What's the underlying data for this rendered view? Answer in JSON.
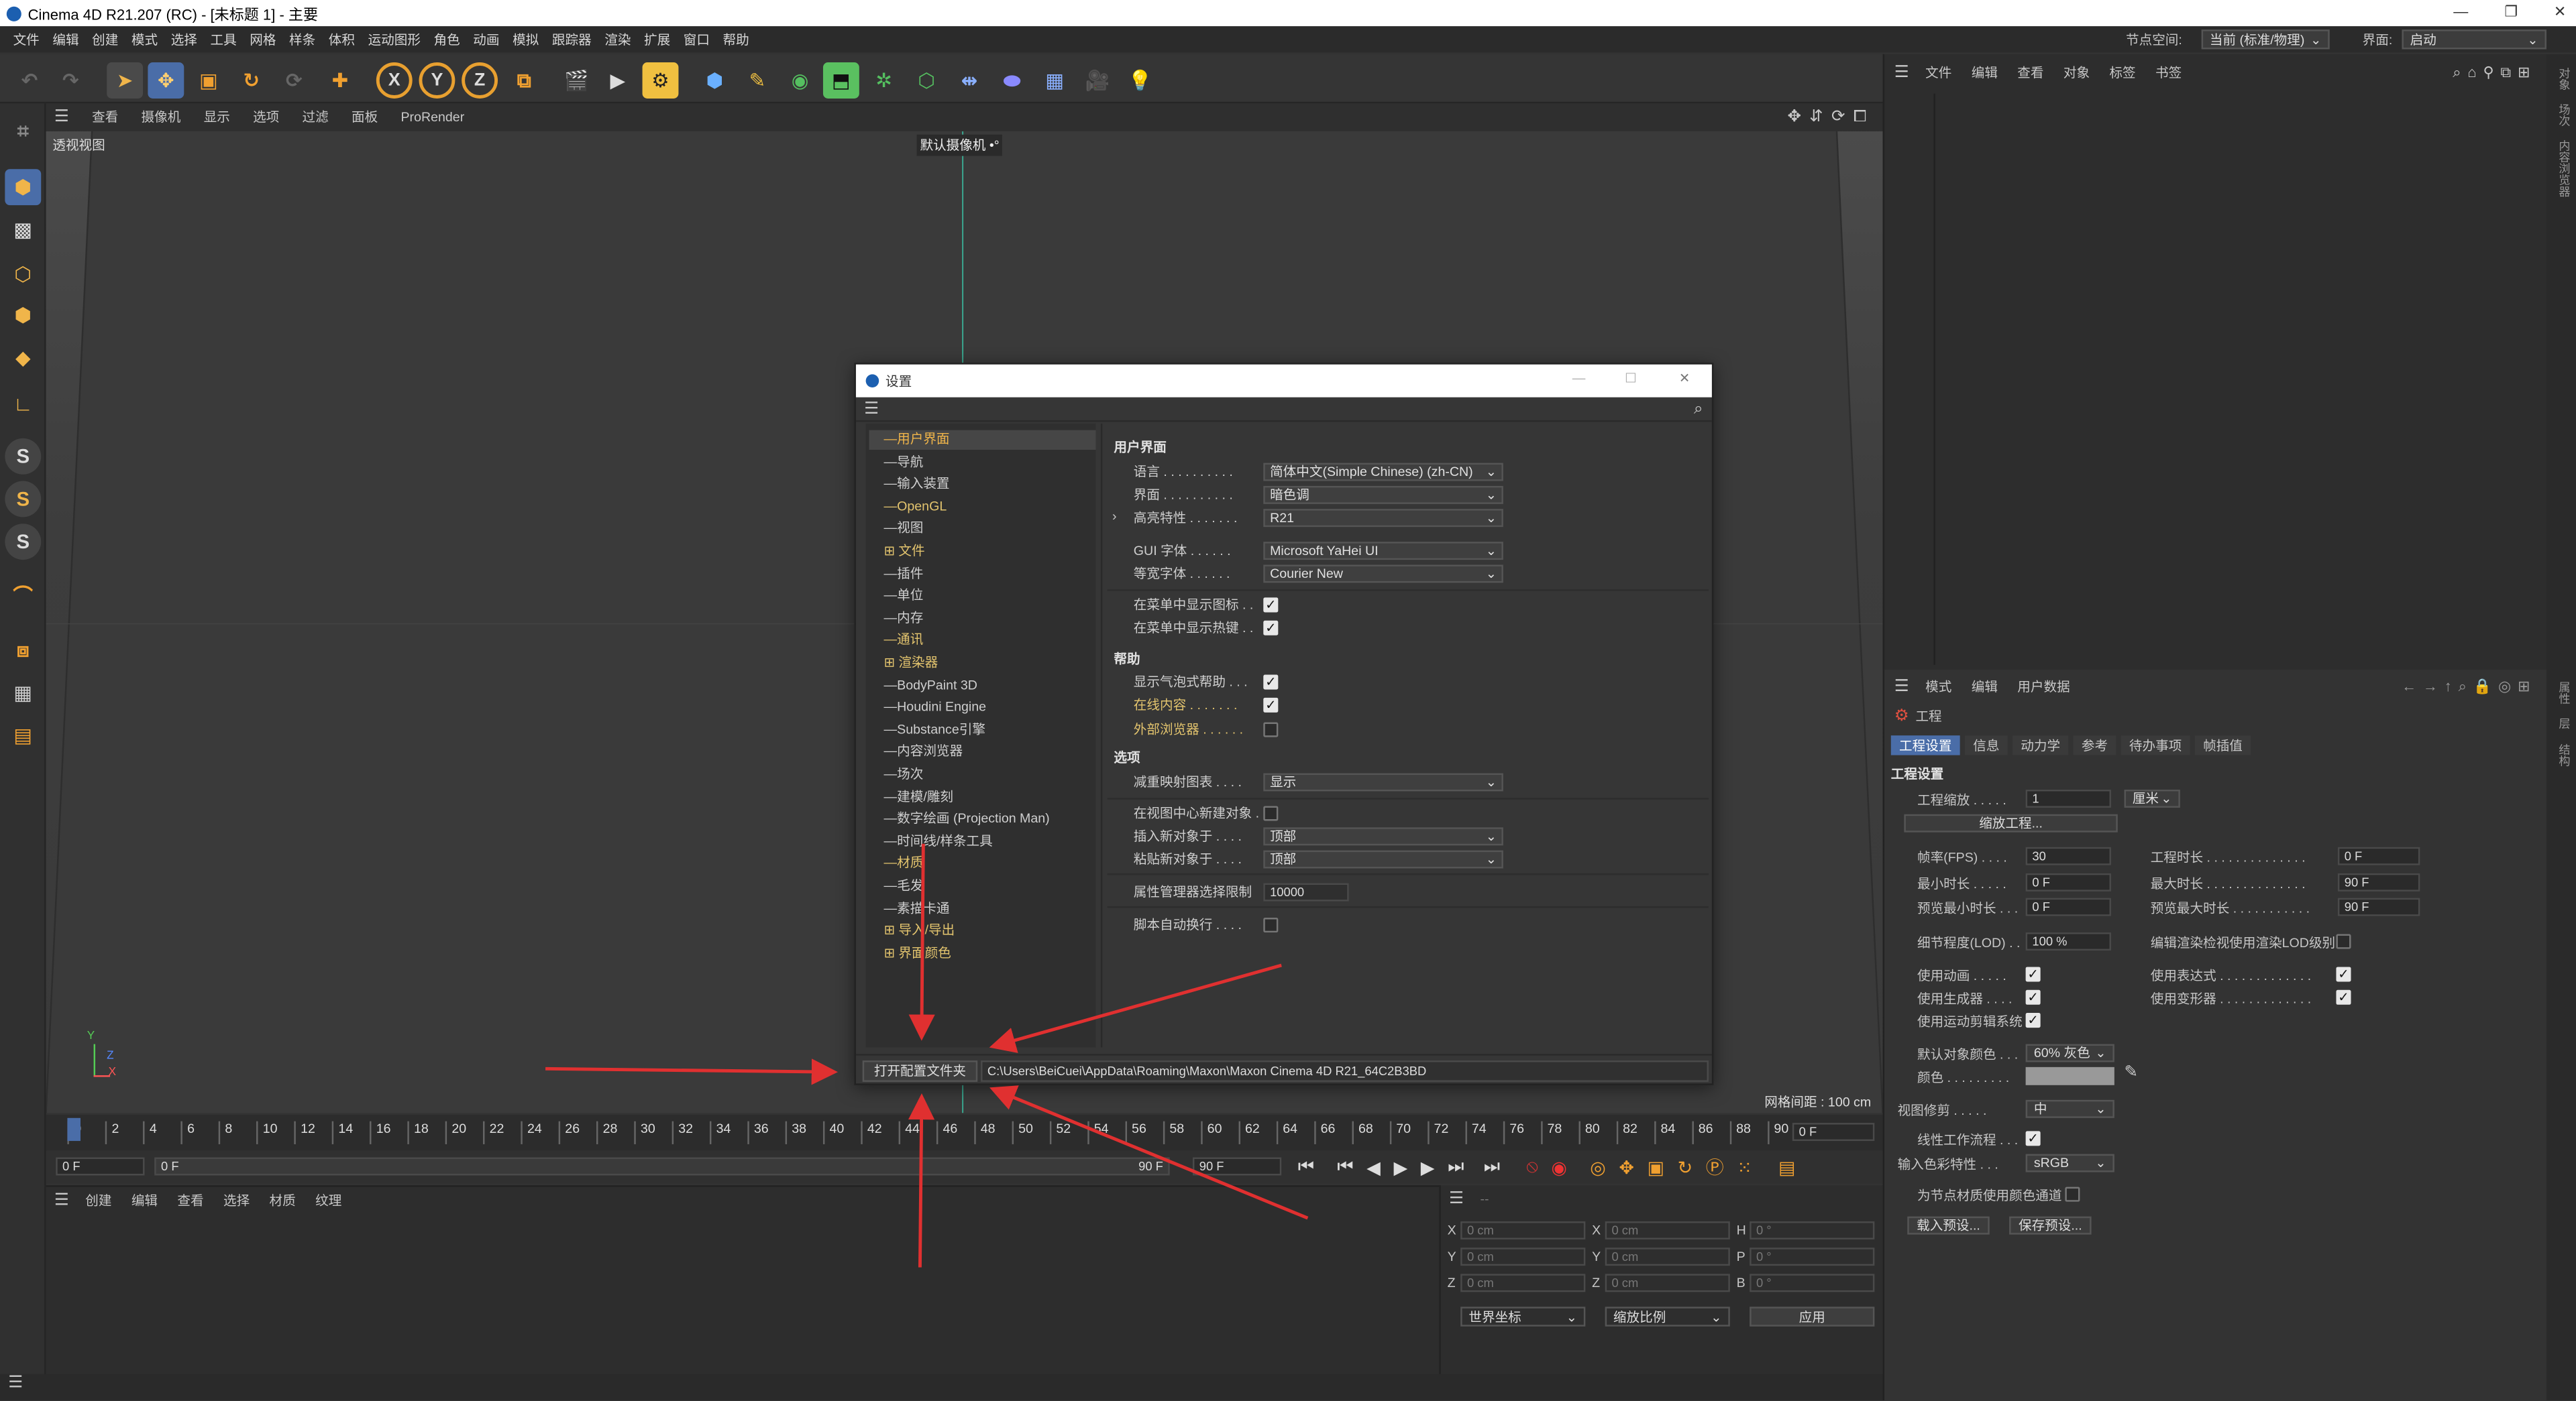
{
  "window": {
    "title": "Cinema 4D R21.207 (RC) - [未标题 1] - 主要",
    "min": "—",
    "max": "❐",
    "close": "✕"
  },
  "menubar": {
    "items": [
      "文件",
      "编辑",
      "创建",
      "模式",
      "选择",
      "工具",
      "网格",
      "样条",
      "体积",
      "运动图形",
      "角色",
      "动画",
      "模拟",
      "跟踪器",
      "渲染",
      "扩展",
      "窗口",
      "帮助"
    ],
    "node_space_label": "节点空间:",
    "node_space_value": "当前 (标准/物理)",
    "interface_label": "界面:",
    "interface_value": "启动"
  },
  "viewport": {
    "menu": [
      "查看",
      "摄像机",
      "显示",
      "选项",
      "过滤",
      "面板",
      "ProRender"
    ],
    "name": "透视视图",
    "camera": "默认摄像机 •°",
    "grid": "网格间距 : 100 cm",
    "axis": {
      "y": "Y",
      "z": "Z",
      "x": "X"
    }
  },
  "timeline": {
    "ticks": [
      "0",
      "2",
      "4",
      "6",
      "8",
      "10",
      "12",
      "14",
      "16",
      "18",
      "20",
      "22",
      "24",
      "26",
      "28",
      "30",
      "32",
      "34",
      "36",
      "38",
      "40",
      "42",
      "44",
      "46",
      "48",
      "50",
      "52",
      "54",
      "56",
      "58",
      "60",
      "62",
      "64",
      "66",
      "68",
      "70",
      "72",
      "74",
      "76",
      "78",
      "80",
      "82",
      "84",
      "86",
      "88",
      "90"
    ],
    "current": "0 F",
    "start": "0 F",
    "range_start": "0 F",
    "range_end": "90 F",
    "end": "90 F"
  },
  "material_panel": {
    "menu": [
      "创建",
      "编辑",
      "查看",
      "选择",
      "材质",
      "纹理"
    ]
  },
  "coord_panel": {
    "rows": [
      {
        "a": "X",
        "av": "0 cm",
        "b": "X",
        "bv": "0 cm",
        "c": "H",
        "cv": "0 °"
      },
      {
        "a": "Y",
        "av": "0 cm",
        "b": "Y",
        "bv": "0 cm",
        "c": "P",
        "cv": "0 °"
      },
      {
        "a": "Z",
        "av": "0 cm",
        "b": "Z",
        "bv": "0 cm",
        "c": "B",
        "cv": "0 °"
      }
    ],
    "world": "世界坐标",
    "scale": "缩放比例",
    "apply": "应用",
    "dash": "--"
  },
  "object_panel": {
    "menu": [
      "文件",
      "编辑",
      "查看",
      "对象",
      "标签",
      "书签"
    ]
  },
  "attr_panel": {
    "menu": [
      "模式",
      "编辑",
      "用户数据"
    ],
    "title": "工程",
    "tabs": [
      "工程设置",
      "信息",
      "动力学",
      "参考",
      "待办事项",
      "帧插值"
    ],
    "section": "工程设置",
    "scale_label": "工程缩放 . . . . .",
    "scale_value": "1",
    "scale_unit": "厘米",
    "scale_btn": "缩放工程...",
    "fps_label": "帧率(FPS) . . . .",
    "fps": "30",
    "dur_label": "工程时长 . . . . . . . . . . . . . .",
    "dur": "0 F",
    "min_label": "最小时长 . . . . .",
    "min": "0 F",
    "max_label": "最大时长 . . . . . . . . . . . . . .",
    "max": "90 F",
    "pmin_label": "预览最小时长 . . .",
    "pmin": "0 F",
    "pmax_label": "预览最大时长 . . . . . . . . . . .",
    "pmax": "90 F",
    "lod_label": "细节程度(LOD) . .",
    "lod": "100 %",
    "lod2_label": "编辑渲染检视使用渲染LOD级别",
    "anim_label": "使用动画 . . . . .",
    "expr_label": "使用表达式 . . . . . . . . . . . . .",
    "gen_label": "使用生成器 . . . .",
    "deform_label": "使用变形器 . . . . . . . . . . . . .",
    "motion_label": "使用运动剪辑系统",
    "defcolor_label": "默认对象颜色 . . .",
    "defcolor": "60% 灰色",
    "color_label": "颜色 . . . . . . . . .",
    "clip_label": "视图修剪 . . . . .",
    "clip": "中",
    "linear_label": "线性工作流程 . . .",
    "input_label": "输入色彩特性 . . .",
    "input": "sRGB",
    "node_label": "为节点材质使用颜色通道",
    "load_btn": "载入预设...",
    "save_btn": "保存预设..."
  },
  "right_strip": [
    "对象",
    "场次",
    "内容浏览器",
    "属性",
    "层",
    "结构"
  ],
  "dialog": {
    "title": "设置",
    "tree": [
      {
        "t": "用户界面",
        "s": "sel"
      },
      {
        "t": "导航"
      },
      {
        "t": "输入装置"
      },
      {
        "t": "OpenGL",
        "s": "gold"
      },
      {
        "t": "视图"
      },
      {
        "t": "文件",
        "s": "gold",
        "p": "⊞"
      },
      {
        "t": "插件"
      },
      {
        "t": "单位"
      },
      {
        "t": "内存"
      },
      {
        "t": "通讯",
        "s": "gold"
      },
      {
        "t": "渲染器",
        "s": "gold",
        "p": "⊞"
      },
      {
        "t": "BodyPaint 3D"
      },
      {
        "t": "Houdini Engine"
      },
      {
        "t": "Substance引擎"
      },
      {
        "t": "内容浏览器"
      },
      {
        "t": "场次"
      },
      {
        "t": "建模/雕刻"
      },
      {
        "t": "数字绘画 (Projection Man)"
      },
      {
        "t": "时间线/样条工具"
      },
      {
        "t": "材质",
        "s": "gold"
      },
      {
        "t": "毛发"
      },
      {
        "t": "素描卡通"
      },
      {
        "t": "导入/导出",
        "s": "gold",
        "p": "⊞"
      },
      {
        "t": "界面颜色",
        "s": "gold",
        "p": "⊞"
      }
    ],
    "sec_ui": "用户界面",
    "lang_label": "语言 . . . . . . . . . .",
    "lang": "简体中文(Simple Chinese) (zh-CN)",
    "scheme_label": "界面 . . . . . . . . . .",
    "scheme": "暗色调",
    "hl_label": "高亮特性 . . . . . . .",
    "hl": "R21",
    "gui_label": "GUI 字体 . . . . . .",
    "gui": "Microsoft YaHei UI",
    "mono_label": "等宽字体 . . . . . .",
    "mono": "Courier New",
    "menuicon_label": "在菜单中显示图标 . .",
    "menukey_label": "在菜单中显示热键 . .",
    "sec_help": "帮助",
    "bubble_label": "显示气泡式帮助 . . .",
    "online_label": "在线内容 . . . . . . .",
    "ext_label": "外部浏览器 . . . . . .",
    "sec_opt": "选项",
    "icons_label": "减重映射图表 . . . .",
    "icons": "显示",
    "center_label": "在视图中心新建对象 .",
    "insert_label": "插入新对象于 . . . .",
    "insert": "顶部",
    "paste_label": "粘贴新对象于 . . . .",
    "paste": "顶部",
    "attr_label": "属性管理器选择限制",
    "attr": "10000",
    "wrap_label": "脚本自动换行 . . . .",
    "open_btn": "打开配置文件夹",
    "path": "C:\\Users\\BeiCuei\\AppData\\Roaming\\Maxon\\Maxon Cinema 4D R21_64C2B3BD"
  },
  "colors": {
    "accent": "#4a6da8",
    "gold": "#e3c46e",
    "arrow": "#e03030",
    "orange": "#f0b54a"
  }
}
